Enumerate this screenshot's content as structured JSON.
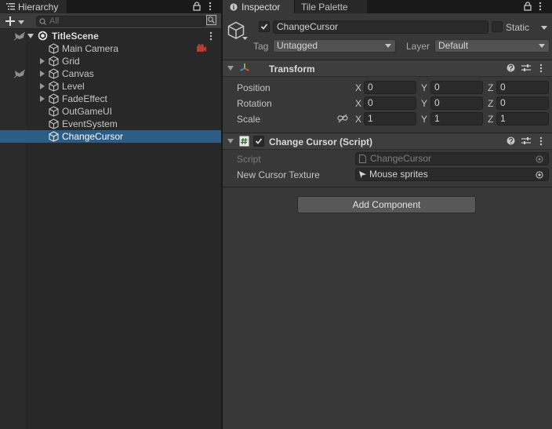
{
  "hierarchy": {
    "tab_label": "Hierarchy",
    "search_placeholder": "All",
    "scene_name": "TitleScene",
    "items": [
      {
        "label": "Main Camera",
        "indent": 1,
        "expandable": false
      },
      {
        "label": "Grid",
        "indent": 1,
        "expandable": true
      },
      {
        "label": "Canvas",
        "indent": 1,
        "expandable": true
      },
      {
        "label": "Level",
        "indent": 1,
        "expandable": true
      },
      {
        "label": "FadeEffect",
        "indent": 1,
        "expandable": true
      },
      {
        "label": "OutGameUI",
        "indent": 1,
        "expandable": false
      },
      {
        "label": "EventSystem",
        "indent": 1,
        "expandable": false
      },
      {
        "label": "ChangeCursor",
        "indent": 1,
        "expandable": false,
        "selected": true
      }
    ]
  },
  "inspector": {
    "tabs": {
      "inspector": "Inspector",
      "tile_palette": "Tile Palette"
    },
    "object_name": "ChangeCursor",
    "static_label": "Static",
    "tag_label": "Tag",
    "tag_value": "Untagged",
    "layer_label": "Layer",
    "layer_value": "Default",
    "transform": {
      "title": "Transform",
      "position": {
        "label": "Position",
        "x": "0",
        "y": "0",
        "z": "0"
      },
      "rotation": {
        "label": "Rotation",
        "x": "0",
        "y": "0",
        "z": "0"
      },
      "scale": {
        "label": "Scale",
        "x": "1",
        "y": "1",
        "z": "1"
      },
      "axis_x": "X",
      "axis_y": "Y",
      "axis_z": "Z"
    },
    "script_component": {
      "title": "Change Cursor (Script)",
      "script_label": "Script",
      "script_value": "ChangeCursor",
      "texture_label": "New Cursor Texture",
      "texture_value": "Mouse sprites"
    },
    "add_component_label": "Add Component"
  },
  "colors": {
    "selection": "#2c5d87",
    "panel_bg": "#383838",
    "hierarchy_bg": "#282828",
    "transform_icon_red": "#e0533f",
    "transform_icon_green": "#7ac943",
    "transform_icon_blue": "#3c8fe0"
  }
}
